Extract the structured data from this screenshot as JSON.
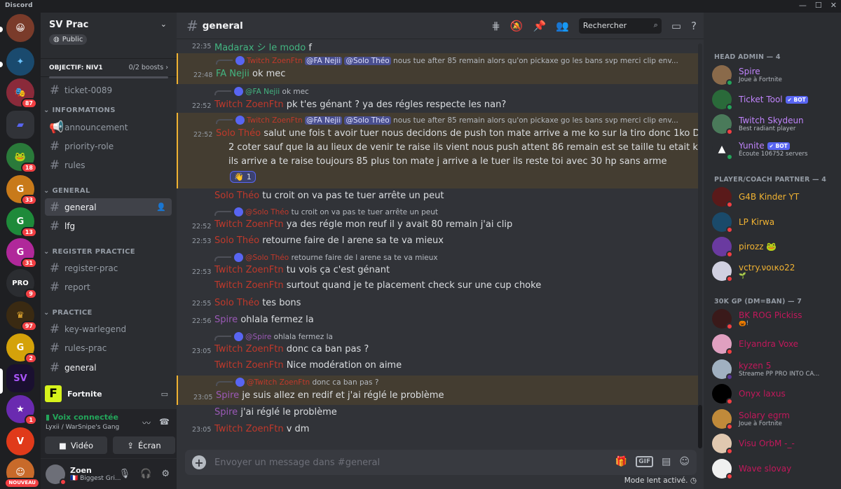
{
  "app": {
    "title": "Discord",
    "window_controls": [
      "—",
      "☐",
      "✕"
    ]
  },
  "server": {
    "name": "SV Prac",
    "public_label": "Public",
    "boost_goal": "OBJECTIF: NIV1",
    "boost_count": "0/2 boosts",
    "boost_progress": 0
  },
  "guild_badges": [
    "18",
    "33",
    "13",
    "31",
    "9",
    "97",
    "2",
    "1",
    "NOUVEAU",
    "87"
  ],
  "channels": {
    "ticket": "ticket-0089",
    "cat_info": "INFORMATIONS",
    "announcement": "announcement",
    "priority": "priority-role",
    "rules": "rules",
    "cat_general": "GENERAL",
    "general": "general",
    "lfg": "lfg",
    "cat_register": "REGISTER PRACTICE",
    "register": "register-prac",
    "report": "report",
    "cat_practice": "PRACTICE",
    "keywar": "key-warlegend",
    "rulesprac": "rules-prac",
    "general2": "general"
  },
  "activity": {
    "name": "Fortnite"
  },
  "voice": {
    "status": "Voix connectée",
    "location": "Lyxii / WarSnipe's Gang",
    "video_label": "Vidéo",
    "screen_label": "Écran"
  },
  "user": {
    "name": "Zoen",
    "status": "🇫🇷 Biggest Gri..."
  },
  "header": {
    "channel": "general",
    "search_placeholder": "Rechercher"
  },
  "messages": {
    "m1": {
      "time": "22:35",
      "author": "Madarax",
      "sym": "シ le modo",
      "text": "f"
    },
    "m2_reply": {
      "author": "Twitch ZoenFtn",
      "m1": "@FA Nejii",
      "m2": "@Solo Théo",
      "text": "nous tue after 85 remain alors qu'on pickaxe go les bans svp merci clip env..."
    },
    "m2": {
      "time": "22:48",
      "author": "FA Nejii",
      "text": "ok mec"
    },
    "m3_reply": {
      "author": "@FA Nejii",
      "text": "ok mec"
    },
    "m3": {
      "time": "22:52",
      "author": "Twitch ZoenFtn",
      "text": "pk t'es génant ? ya des régles respecte les nan?"
    },
    "m4_reply": {
      "author": "Twitch ZoenFtn",
      "m1": "@FA Nejii",
      "m2": "@Solo Théo",
      "text": "nous tue after 85 remain alors qu'on pickaxe go les bans svp merci clip env..."
    },
    "m4": {
      "time": "22:52",
      "author": "Solo Théo",
      "l1": "salut une fois t avoir tuer nous decidons de push ton mate arrive a me ko sur la tiro donc 1ko Des",
      "l2": "2 coter sauf que la au lieux de venir te raise ils vient nous push attent 86 remain est se taille tu etait ko",
      "l3": "ils arrive a te raise toujours 85 plus ton mate j arrive a le tuer ils reste toi avec 30 hp sans arme",
      "reaction": "👋",
      "reaction_count": "1"
    },
    "m5": {
      "author": "Solo Théo",
      "text": "tu croit on va pas te tuer arrête un peut"
    },
    "m6_reply": {
      "author": "@Solo Théo",
      "text": "tu croit on va pas te tuer arrête un peut"
    },
    "m6": {
      "time": "22:52",
      "author": "Twitch ZoenFtn",
      "text": "ya des régle mon reuf il y avait 80 remain j'ai clip"
    },
    "m7": {
      "time": "22:53",
      "author": "Solo Théo",
      "text": "retourne faire de l arene sa te va mieux"
    },
    "m8_reply": {
      "author": "@Solo Théo",
      "text": "retourne faire de l arene sa te va mieux"
    },
    "m8": {
      "time": "22:53",
      "author": "Twitch ZoenFtn",
      "text": "tu vois ça c'est génant"
    },
    "m9": {
      "author": "Twitch ZoenFtn",
      "text": "surtout quand je te placement check sur une cup choke"
    },
    "m10": {
      "time": "22:55",
      "author": "Solo Théo",
      "text": "tes bons"
    },
    "m11": {
      "time": "22:56",
      "author": "Spire",
      "text": "ohlala fermez la"
    },
    "m12_reply": {
      "author": "@Spire",
      "text": "ohlala fermez la"
    },
    "m12": {
      "time": "23:05",
      "author": "Twitch ZoenFtn",
      "text": "donc ca ban pas ?"
    },
    "m13": {
      "author": "Twitch ZoenFtn",
      "text": "Nice modération on aime"
    },
    "m14_reply": {
      "author": "@Twitch ZoenFtn",
      "text": "donc ca ban pas ?"
    },
    "m14": {
      "time": "23:05",
      "author": "Spire",
      "text": "je suis allez en redif et j'ai réglé le problème"
    },
    "m15": {
      "author": "Spire",
      "text": "j'ai réglé le problème"
    },
    "m16": {
      "time": "23:05",
      "author": "Twitch ZoenFtn",
      "text": "v dm"
    }
  },
  "composer": {
    "placeholder": "Envoyer un message dans #general",
    "gif": "GIF",
    "slow_mode": "Mode lent activé."
  },
  "members": {
    "cat1": "HEAD ADMIN — 4",
    "spire": {
      "name": "Spire",
      "sub": "Joue à Fortnite"
    },
    "ticket": {
      "name": "Ticket Tool",
      "badge": "✔ BOT"
    },
    "skydeun": {
      "name": "Twitch Skydeun",
      "sub": "Best radiant player"
    },
    "yunite": {
      "name": "Yunite",
      "badge": "✔ BOT",
      "sub": "Écoute 106752 servers"
    },
    "cat2": "PLAYER/COACH PARTNER — 4",
    "g4b": {
      "name": "G4B Kinder YT"
    },
    "lp": {
      "name": "LP Kirwa"
    },
    "pirozz": {
      "name": "pirozz",
      "emoji": "🐸"
    },
    "vctry": {
      "name": "vctry.νοικο22",
      "sub": "🌱"
    },
    "cat3": "30K GP (DM=BAN) — 7",
    "bk": {
      "name": "BK ROG Pickiss",
      "sub": "🎃!"
    },
    "elyandra": {
      "name": "Elyandra Voxe"
    },
    "kyzen": {
      "name": "kyzen 5",
      "sub": "Streame PP PRO INTO CA..."
    },
    "onyx": {
      "name": "Onyx laxus"
    },
    "solary": {
      "name": "Solary egrm",
      "sub": "Joue à Fortnite"
    },
    "visu": {
      "name": "Visu OrbM -_-"
    },
    "wave": {
      "name": "Wave slovay"
    }
  },
  "colors": {
    "accent": "#5865f2",
    "online": "#23a55a",
    "dnd": "#f23f43",
    "mention_bg": "#443d31"
  }
}
